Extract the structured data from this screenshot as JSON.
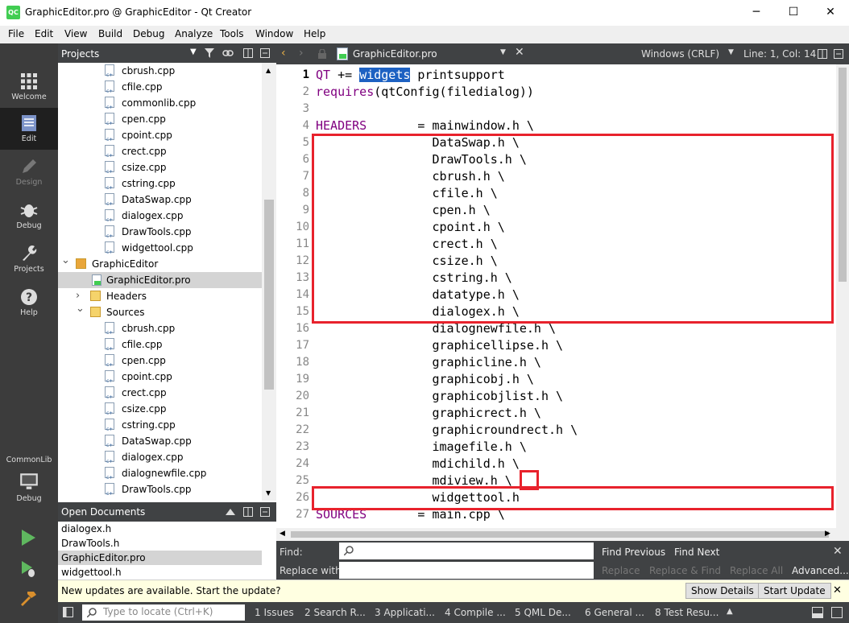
{
  "window": {
    "title": "GraphicEditor.pro @ GraphicEditor - Qt Creator",
    "app_icon": "QC",
    "minimize": "─",
    "maximize": "☐",
    "close": "✕"
  },
  "menu": [
    "File",
    "Edit",
    "View",
    "Build",
    "Debug",
    "Analyze",
    "Tools",
    "Window",
    "Help"
  ],
  "modes": [
    {
      "label": "Welcome",
      "icon": "grid-icon"
    },
    {
      "label": "Edit",
      "icon": "document-icon",
      "active": true
    },
    {
      "label": "Design",
      "icon": "pencil-icon",
      "disabled": true
    },
    {
      "label": "Debug",
      "icon": "bug-icon"
    },
    {
      "label": "Projects",
      "icon": "wrench-icon"
    },
    {
      "label": "Help",
      "icon": "help-icon"
    }
  ],
  "kit": {
    "name": "CommonLib",
    "build": "Debug"
  },
  "projects_panel": {
    "title": "Projects"
  },
  "tree": [
    {
      "name": "cbrush.cpp",
      "depth": 2,
      "type": "cpp"
    },
    {
      "name": "cfile.cpp",
      "depth": 2,
      "type": "cpp"
    },
    {
      "name": "commonlib.cpp",
      "depth": 2,
      "type": "cpp"
    },
    {
      "name": "cpen.cpp",
      "depth": 2,
      "type": "cpp"
    },
    {
      "name": "cpoint.cpp",
      "depth": 2,
      "type": "cpp"
    },
    {
      "name": "crect.cpp",
      "depth": 2,
      "type": "cpp"
    },
    {
      "name": "csize.cpp",
      "depth": 2,
      "type": "cpp"
    },
    {
      "name": "cstring.cpp",
      "depth": 2,
      "type": "cpp"
    },
    {
      "name": "DataSwap.cpp",
      "depth": 2,
      "type": "cpp"
    },
    {
      "name": "dialogex.cpp",
      "depth": 2,
      "type": "cpp"
    },
    {
      "name": "DrawTools.cpp",
      "depth": 2,
      "type": "cpp"
    },
    {
      "name": "widgettool.cpp",
      "depth": 2,
      "type": "cpp"
    },
    {
      "name": "GraphicEditor",
      "depth": 0,
      "type": "project",
      "expanded": true
    },
    {
      "name": "GraphicEditor.pro",
      "depth": 1,
      "type": "pro",
      "selected": true
    },
    {
      "name": "Headers",
      "depth": 1,
      "type": "folder-h",
      "expanded": false
    },
    {
      "name": "Sources",
      "depth": 1,
      "type": "folder-cpp",
      "expanded": true
    },
    {
      "name": "cbrush.cpp",
      "depth": 2,
      "type": "cpp"
    },
    {
      "name": "cfile.cpp",
      "depth": 2,
      "type": "cpp"
    },
    {
      "name": "cpen.cpp",
      "depth": 2,
      "type": "cpp"
    },
    {
      "name": "cpoint.cpp",
      "depth": 2,
      "type": "cpp"
    },
    {
      "name": "crect.cpp",
      "depth": 2,
      "type": "cpp"
    },
    {
      "name": "csize.cpp",
      "depth": 2,
      "type": "cpp"
    },
    {
      "name": "cstring.cpp",
      "depth": 2,
      "type": "cpp"
    },
    {
      "name": "DataSwap.cpp",
      "depth": 2,
      "type": "cpp"
    },
    {
      "name": "dialogex.cpp",
      "depth": 2,
      "type": "cpp"
    },
    {
      "name": "dialognewfile.cpp",
      "depth": 2,
      "type": "cpp"
    },
    {
      "name": "DrawTools.cpp",
      "depth": 2,
      "type": "cpp"
    }
  ],
  "open_documents": {
    "title": "Open Documents",
    "items": [
      {
        "name": "dialogex.h"
      },
      {
        "name": "DrawTools.h"
      },
      {
        "name": "GraphicEditor.pro",
        "selected": true
      },
      {
        "name": "widgettool.h"
      }
    ]
  },
  "editor": {
    "file": "GraphicEditor.pro",
    "line_ending": "Windows (CRLF)",
    "position": "Line: 1, Col: 14"
  },
  "code": [
    {
      "n": 1,
      "parts": [
        {
          "t": "QT",
          "c": "kw"
        },
        {
          "t": " += "
        },
        {
          "t": "widgets",
          "c": "hl"
        },
        {
          "t": " printsupport"
        }
      ]
    },
    {
      "n": 2,
      "parts": [
        {
          "t": "requires",
          "c": "kw"
        },
        {
          "t": "(qtConfig(filedialog))"
        }
      ]
    },
    {
      "n": 3,
      "parts": []
    },
    {
      "n": 4,
      "parts": [
        {
          "t": "HEADERS",
          "c": "kw"
        },
        {
          "t": "       = mainwindow.h \\"
        }
      ]
    },
    {
      "n": 5,
      "parts": [
        {
          "t": "                DataSwap.h \\"
        }
      ]
    },
    {
      "n": 6,
      "parts": [
        {
          "t": "                DrawTools.h \\"
        }
      ]
    },
    {
      "n": 7,
      "parts": [
        {
          "t": "                cbrush.h \\"
        }
      ]
    },
    {
      "n": 8,
      "parts": [
        {
          "t": "                cfile.h \\"
        }
      ]
    },
    {
      "n": 9,
      "parts": [
        {
          "t": "                cpen.h \\"
        }
      ]
    },
    {
      "n": 10,
      "parts": [
        {
          "t": "                cpoint.h \\"
        }
      ]
    },
    {
      "n": 11,
      "parts": [
        {
          "t": "                crect.h \\"
        }
      ]
    },
    {
      "n": 12,
      "parts": [
        {
          "t": "                csize.h \\"
        }
      ]
    },
    {
      "n": 13,
      "parts": [
        {
          "t": "                cstring.h \\"
        }
      ]
    },
    {
      "n": 14,
      "parts": [
        {
          "t": "                datatype.h \\"
        }
      ]
    },
    {
      "n": 15,
      "parts": [
        {
          "t": "                dialogex.h \\"
        }
      ]
    },
    {
      "n": 16,
      "parts": [
        {
          "t": "                dialognewfile.h \\"
        }
      ]
    },
    {
      "n": 17,
      "parts": [
        {
          "t": "                graphicellipse.h \\"
        }
      ]
    },
    {
      "n": 18,
      "parts": [
        {
          "t": "                graphicline.h \\"
        }
      ]
    },
    {
      "n": 19,
      "parts": [
        {
          "t": "                graphicobj.h \\"
        }
      ]
    },
    {
      "n": 20,
      "parts": [
        {
          "t": "                graphicobjlist.h \\"
        }
      ]
    },
    {
      "n": 21,
      "parts": [
        {
          "t": "                graphicrect.h \\"
        }
      ]
    },
    {
      "n": 22,
      "parts": [
        {
          "t": "                graphicroundrect.h \\"
        }
      ]
    },
    {
      "n": 23,
      "parts": [
        {
          "t": "                imagefile.h \\"
        }
      ]
    },
    {
      "n": 24,
      "parts": [
        {
          "t": "                mdichild.h \\"
        }
      ]
    },
    {
      "n": 25,
      "parts": [
        {
          "t": "                mdiview.h \\"
        }
      ]
    },
    {
      "n": 26,
      "parts": [
        {
          "t": "                widgettool.h"
        }
      ]
    },
    {
      "n": 27,
      "parts": [
        {
          "t": "SOURCES",
          "c": "kw"
        },
        {
          "t": "       = main.cpp \\"
        }
      ]
    }
  ],
  "find": {
    "find_label": "Find:",
    "replace_label": "Replace with:",
    "find_previous": "Find Previous",
    "find_next": "Find Next",
    "replace": "Replace",
    "replace_find": "Replace & Find",
    "replace_all": "Replace All",
    "advanced": "Advanced..."
  },
  "update": {
    "message": "New updates are available. Start the update?",
    "show_details": "Show Details",
    "start_update": "Start Update"
  },
  "status": {
    "locate_placeholder": "Type to locate (Ctrl+K)",
    "panes": [
      "1  Issues",
      "2  Search R...",
      "3  Applicati...",
      "4  Compile ...",
      "5  QML De...",
      "6  General ...",
      "8  Test Resu..."
    ]
  }
}
